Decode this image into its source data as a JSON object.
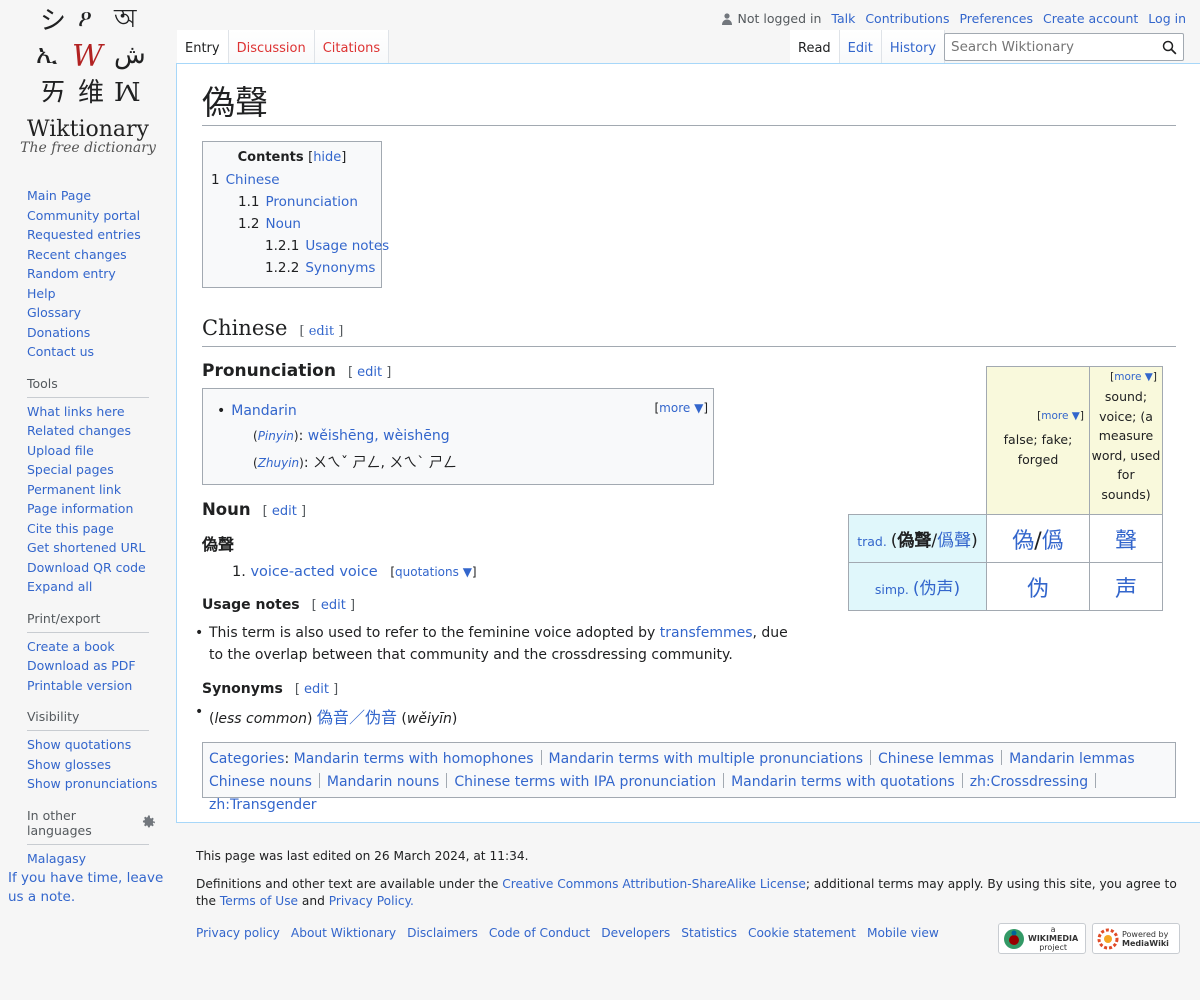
{
  "logo": {
    "glyphs": [
      "シ",
      "ዖ",
      "অ",
      "ኢ",
      "W",
      "ش",
      "ㄞ",
      "维",
      "ꟽ"
    ],
    "name": "Wiktionary",
    "tagline": "The free dictionary"
  },
  "nav": [
    "Main Page",
    "Community portal",
    "Requested entries",
    "Recent changes",
    "Random entry",
    "Help",
    "Glossary",
    "Donations",
    "Contact us"
  ],
  "tools": {
    "heading": "Tools",
    "items": [
      "What links here",
      "Related changes",
      "Upload file",
      "Special pages",
      "Permanent link",
      "Page information",
      "Cite this page",
      "Get shortened URL",
      "Download QR code",
      "Expand all"
    ]
  },
  "print": {
    "heading": "Print/export",
    "items": [
      "Create a book",
      "Download as PDF",
      "Printable version"
    ]
  },
  "visibility": {
    "heading": "Visibility",
    "items": [
      "Show quotations",
      "Show glosses",
      "Show pronunciations"
    ]
  },
  "languages": {
    "heading": "In other languages",
    "items": [
      "Malagasy"
    ]
  },
  "leave_note": "If you have time, leave us a note.",
  "personal": {
    "not_logged_in": "Not logged in",
    "talk": "Talk",
    "contributions": "Contributions",
    "preferences": "Preferences",
    "create_account": "Create account",
    "log_in": "Log in"
  },
  "tabs_left": {
    "entry": "Entry",
    "discussion": "Discussion",
    "citations": "Citations"
  },
  "tabs_right": {
    "read": "Read",
    "edit": "Edit",
    "history": "History"
  },
  "search": {
    "placeholder": "Search Wiktionary"
  },
  "page": {
    "title": "偽聲",
    "toc": {
      "title": "Contents",
      "hide": "hide",
      "entries": [
        {
          "num": "1",
          "label": "Chinese"
        },
        {
          "num": "1.1",
          "label": "Pronunciation"
        },
        {
          "num": "1.2",
          "label": "Noun"
        },
        {
          "num": "1.2.1",
          "label": "Usage notes"
        },
        {
          "num": "1.2.2",
          "label": "Synonyms"
        }
      ]
    },
    "edit": "edit",
    "h_chinese": "Chinese",
    "h_pron": "Pronunciation",
    "pron": {
      "language": "Mandarin",
      "more": "more ▼",
      "pinyin_label": "Pinyin",
      "pinyin": "wěishēng, wèishēng",
      "zhuyin_label": "Zhuyin",
      "zhuyin": "ㄨㄟˇ ㄕㄥ, ㄨㄟˋ ㄕㄥ"
    },
    "h_noun": "Noun",
    "headword": "偽聲",
    "definition": {
      "num": "1.",
      "text": "voice-acted voice",
      "quotations": "quotations ▼"
    },
    "h_usage": "Usage notes",
    "usage": {
      "before": "This term is also used to refer to the feminine voice adopted by ",
      "link": "transfemmes",
      "after": ", due to the overlap between that community and the crossdressing community."
    },
    "h_syn": "Synonyms",
    "syn": {
      "qualifier": "less common",
      "trad": "偽音",
      "slash": "／",
      "simp": "伪音",
      "pinyin": "wěiyīn"
    },
    "chars": {
      "more": "more ▼",
      "gloss1": "false; fake; forged",
      "gloss2": "sound; voice; (a measure word, used for sounds)",
      "trad_label": "trad.",
      "trad_word": "偽聲",
      "trad_alt": "僞聲",
      "char1_trad": "偽",
      "char1_alt": "僞",
      "char2_trad": "聲",
      "simp_label": "simp.",
      "simp_word": "伪声",
      "char1_simp": "伪",
      "char2_simp": "声"
    },
    "categories": {
      "label": "Categories",
      "items": [
        "Mandarin terms with homophones",
        "Mandarin terms with multiple pronunciations",
        "Chinese lemmas",
        "Mandarin lemmas",
        "Chinese nouns",
        "Mandarin nouns",
        "Chinese terms with IPA pronunciation",
        "Mandarin terms with quotations",
        "zh:Crossdressing",
        "zh:Transgender"
      ]
    }
  },
  "footer": {
    "last_edited": "This page was last edited on 26 March 2024, at 11:34.",
    "license_before": "Definitions and other text are available under the ",
    "license_link": "Creative Commons Attribution-ShareAlike License",
    "license_mid": "; additional terms may apply. By using this site, you agree to the ",
    "terms_link": "Terms of Use",
    "and": " and ",
    "privacy_link": "Privacy Policy.",
    "places": [
      "Privacy policy",
      "About Wiktionary",
      "Disclaimers",
      "Code of Conduct",
      "Developers",
      "Statistics",
      "Cookie statement",
      "Mobile view"
    ],
    "wikimedia_badge": [
      "a",
      "WIKIMEDIA",
      "project"
    ],
    "mediawiki_badge": [
      "Powered by",
      "MediaWiki"
    ]
  },
  "colors": {
    "link": "#3366cc",
    "new_link": "#dd3333",
    "gloss_bg": "#f9f9dc",
    "label_bg": "#e0f7fb"
  }
}
